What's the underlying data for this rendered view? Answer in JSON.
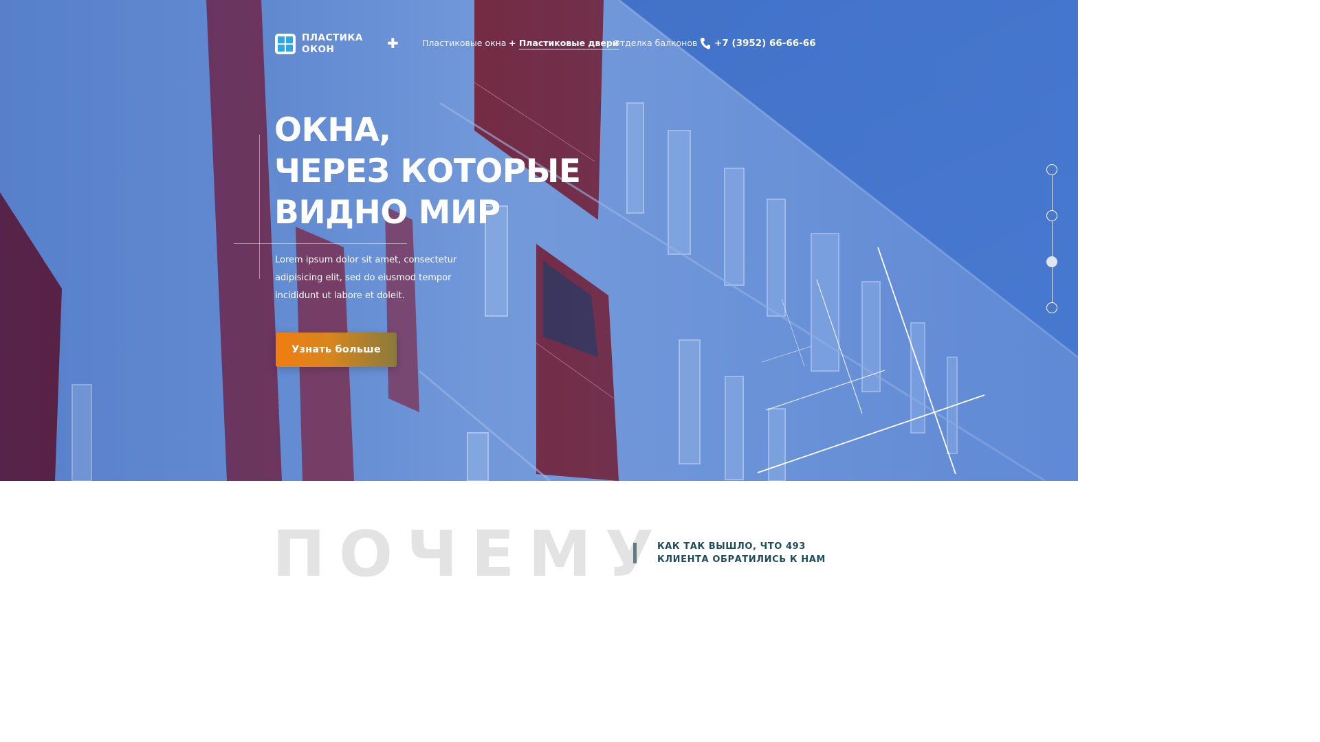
{
  "brand": {
    "name": "ПЛАСТИКА ОКОН",
    "accent": "#2aa8e8"
  },
  "header": {
    "menu_icon": "plus-icon",
    "nav": [
      {
        "label": "Пластиковые окна",
        "active": false
      },
      {
        "label": "Пластиковые двери",
        "prefix": "+",
        "active": true
      },
      {
        "label": "Отделка балконов",
        "active": false
      }
    ],
    "phone": "+7 (3952) 66-66-66",
    "phone_icon": "phone-icon"
  },
  "hero": {
    "title_lines": [
      "ОКНА,",
      "ЧЕРЕЗ КОТОРЫЕ",
      "ВИДНО МИР"
    ],
    "lead": "Lorem ipsum dolor sit amet, consectetur adipisicing elit, sed do eiusmod tempor incididunt ut labore et doleit.",
    "cta_label": "Узнать больше",
    "cta_colors": [
      "#f07d10",
      "#8a7a3c"
    ],
    "slides": {
      "count": 4,
      "active_index": 3
    }
  },
  "why": {
    "title": "ПОЧЕМУ",
    "subtitle": "КАК ТАК ВЫШЛО, ЧТО 493 КЛИЕНТА ОБРАТИЛИСЬ К НАМ"
  }
}
